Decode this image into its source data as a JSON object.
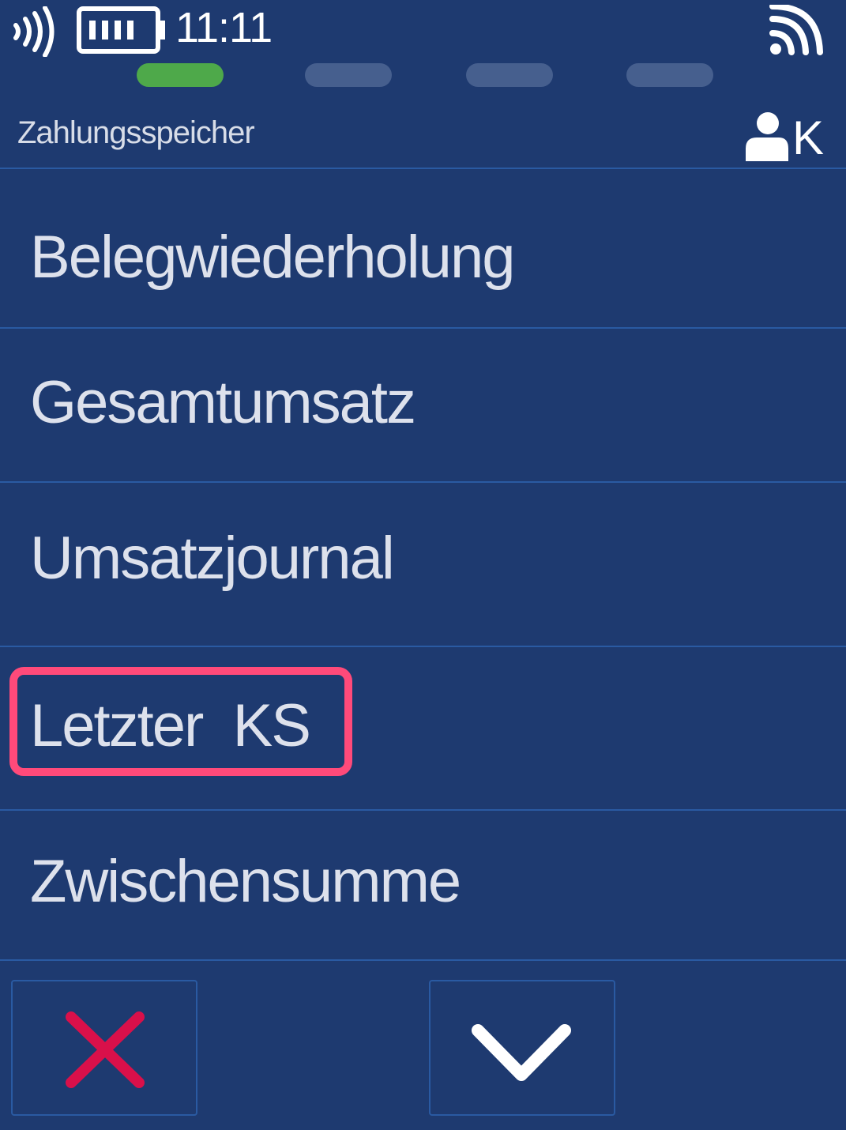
{
  "status_bar": {
    "time": "11:11",
    "icons": [
      "contactless-icon",
      "battery-icon",
      "wifi-icon"
    ]
  },
  "pager": {
    "count": 4,
    "active_index": 0,
    "active_color": "#4ea94a",
    "inactive_color": "#465f8e"
  },
  "header": {
    "title": "Zahlungsspeicher",
    "user_label": "K"
  },
  "menu": {
    "items": [
      {
        "label": "Belegwiederholung"
      },
      {
        "label": "Gesamtumsatz"
      },
      {
        "label": "Umsatzjournal"
      },
      {
        "label": "Letzter  KS",
        "highlighted": true
      },
      {
        "label": "Zwischensumme"
      }
    ]
  },
  "footer": {
    "cancel_icon": "close-icon",
    "next_icon": "chevron-down-icon"
  },
  "colors": {
    "background": "#1e3a70",
    "divider": "#2a5aa2",
    "highlight": "#ff4a7a",
    "cancel": "#d9104a",
    "text": "#dde1ec"
  }
}
